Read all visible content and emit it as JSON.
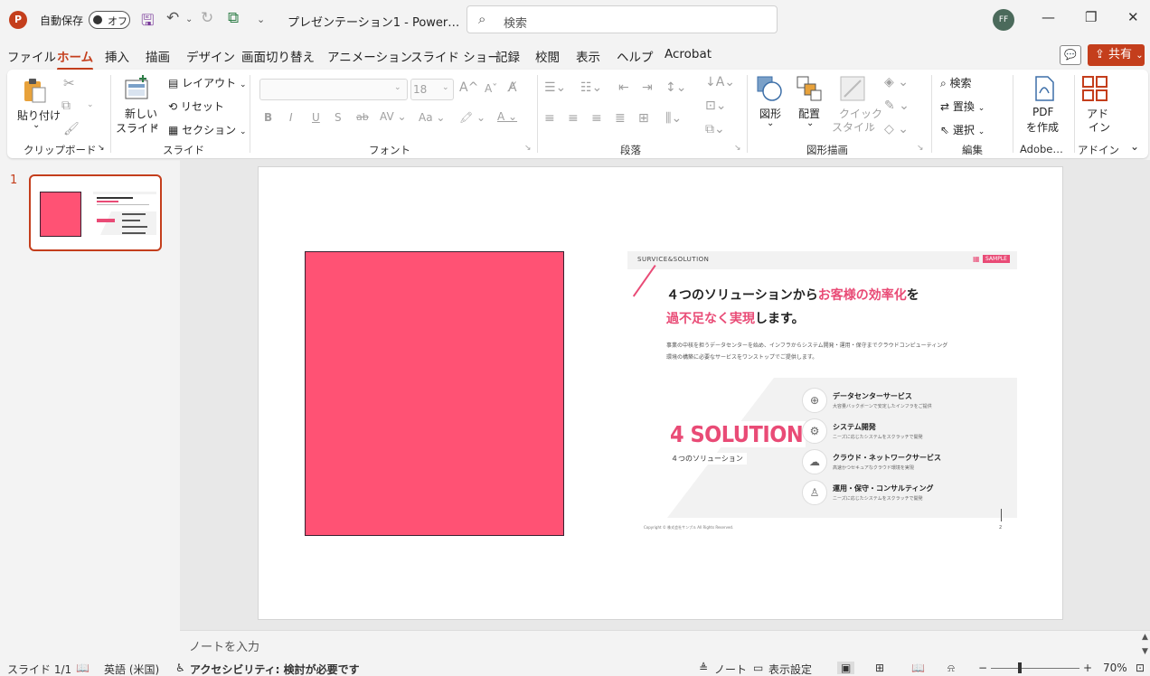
{
  "titlebar": {
    "app_logo": "P",
    "autosave_label": "自動保存",
    "autosave_state": "オフ",
    "doc_title": "プレゼンテーション1 - Power…",
    "search_placeholder": "検索",
    "avatar_initials": "FF"
  },
  "menu": {
    "tabs": [
      "ファイル",
      "ホーム",
      "挿入",
      "描画",
      "デザイン",
      "画面切り替え",
      "アニメーション",
      "スライド ショー",
      "記録",
      "校閲",
      "表示",
      "ヘルプ",
      "Acrobat"
    ],
    "active": "ホーム",
    "share_label": "共有"
  },
  "ribbon": {
    "clipboard": {
      "paste": "貼り付け",
      "label": "クリップボード"
    },
    "slides": {
      "new_slide_1": "新しい",
      "new_slide_2": "スライド",
      "layout": "レイアウト",
      "reset": "リセット",
      "section": "セクション",
      "label": "スライド"
    },
    "font": {
      "size": "18",
      "bold": "B",
      "italic": "I",
      "underline": "U",
      "shadow": "S",
      "strike": "ab",
      "label": "フォント"
    },
    "paragraph": {
      "label": "段落"
    },
    "drawing": {
      "shapes": "図形",
      "arrange": "配置",
      "quick_styles_1": "クイック",
      "quick_styles_2": "スタイル",
      "label": "図形描画"
    },
    "editing": {
      "find": "検索",
      "replace": "置換",
      "select": "選択",
      "label": "編集"
    },
    "adobe": {
      "pdf_1": "PDF",
      "pdf_2": "を作成",
      "label": "Adobe…"
    },
    "addin": {
      "addin_1": "アド",
      "addin_2": "イン",
      "label": "アドイン"
    }
  },
  "thumbnails": {
    "slide_number": "1"
  },
  "slide": {
    "header_tag": "SURVICE&SOLUTION",
    "sample_badge": "SAMPLE",
    "headline_1a": "４つのソリューションから",
    "headline_1b": "お客様の効率化",
    "headline_1c": "を",
    "headline_2a": "過不足なく実現",
    "headline_2b": "します。",
    "desc_1": "事業の中核を担うデータセンターを始め、インフラからシステム開発・運用・保守までクラウドコンピューティング",
    "desc_2": "環境の構築に必要なサービスをワンストップでご提供します。",
    "big_label": "4 SOLUTION",
    "big_sub": "４つのソリューション",
    "services": [
      {
        "title": "データセンターサービス",
        "sub": "大容量バックボーンで安定したインフラをご提供"
      },
      {
        "title": "システム開発",
        "sub": "ニーズに応じたシステムをスクラッチで開発"
      },
      {
        "title": "クラウド・ネットワークサービス",
        "sub": "高速かつセキュアなクラウド環境を実現"
      },
      {
        "title": "運用・保守・コンサルティング",
        "sub": "ニーズに応じたシステムをスクラッチで開発"
      }
    ],
    "copyright": "Copyright © 株式会社サンプル All Rights Reserved.",
    "page_number": "2",
    "accent_color": "#e94b76"
  },
  "notes_placeholder": "ノートを入力",
  "status": {
    "slide_info": "スライド 1/1",
    "language": "英語 (米国)",
    "accessibility": "アクセシビリティ: 検討が必要です",
    "notes": "ノート",
    "display_settings": "表示設定",
    "zoom": "70%"
  }
}
